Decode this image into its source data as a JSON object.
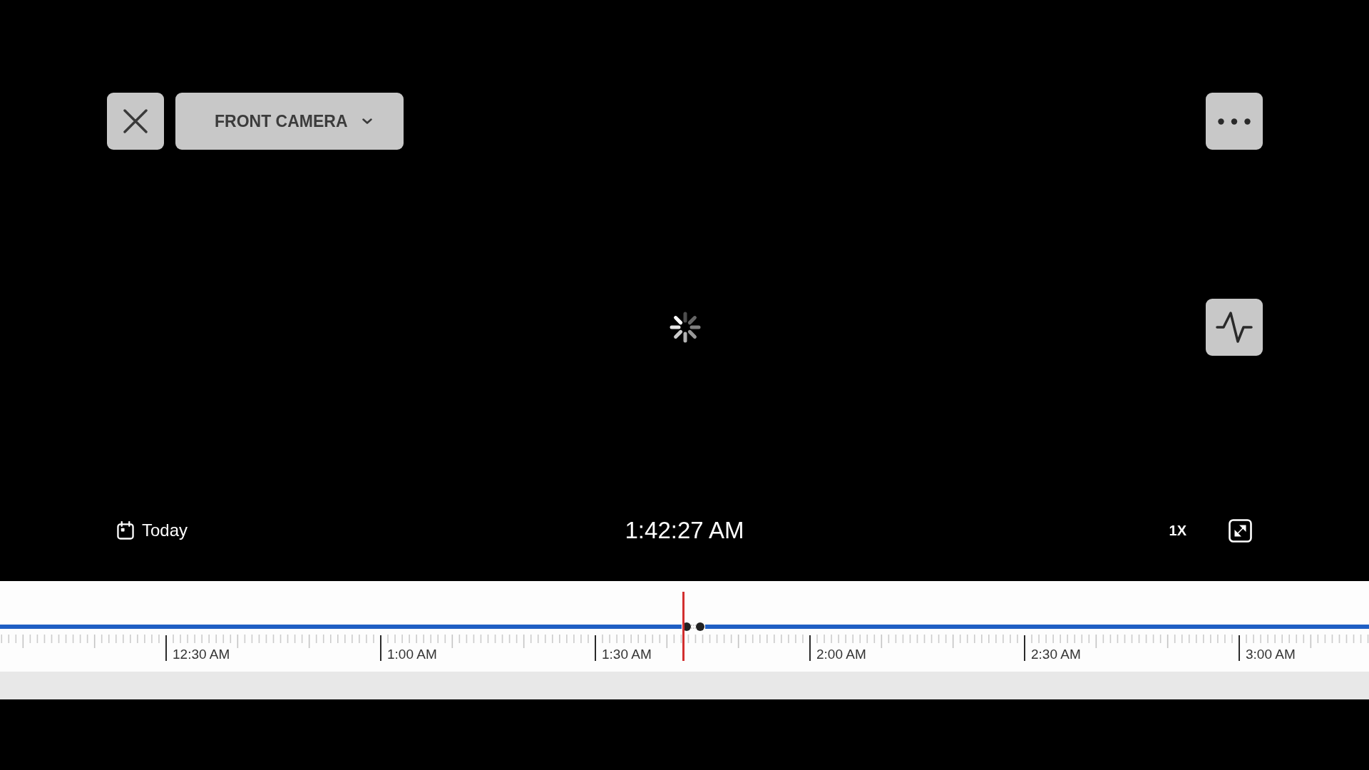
{
  "camera_selector": {
    "label": "FRONT CAMERA"
  },
  "player": {
    "loading": true
  },
  "playback_bar": {
    "date": "Today",
    "time": "1:42:27 AM",
    "speed": "1X"
  },
  "timeline": {
    "labels": [
      "12:30 AM",
      "1:00 AM",
      "1:30 AM",
      "2:00 AM",
      "2:30 AM",
      "3:00 AM"
    ]
  }
}
